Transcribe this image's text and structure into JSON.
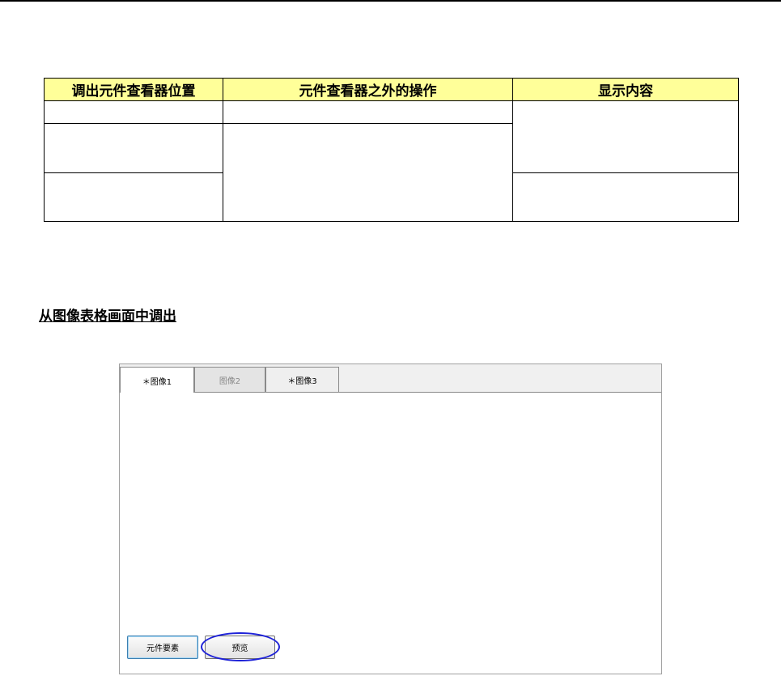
{
  "table": {
    "headers": [
      "调出元件查看器位置",
      "元件查看器之外的操作",
      "显示内容"
    ]
  },
  "section": {
    "title": "从图像表格画面中调出"
  },
  "window": {
    "tabs": [
      {
        "label": "＊图像1",
        "state": "active"
      },
      {
        "label": "图像2",
        "state": "disabled"
      },
      {
        "label": "＊图像3",
        "state": "normal"
      }
    ],
    "buttons": {
      "component_label": "元件要素",
      "preview_label": "预览"
    }
  },
  "colors": {
    "header_fill": "#ffff99",
    "highlight_ellipse": "#1e22d8"
  }
}
